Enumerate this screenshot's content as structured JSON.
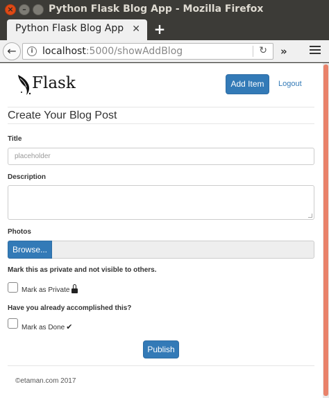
{
  "window": {
    "title": "Python Flask Blog App - Mozilla Firefox"
  },
  "tab": {
    "label": "Python Flask Blog App",
    "close": "✕",
    "new_tab": "+"
  },
  "nav": {
    "url_host": "localhost",
    "url_rest": ":5000/showAddBlog",
    "overflow": "»"
  },
  "header": {
    "logo_text": "Flask",
    "add_item": "Add Item",
    "logout": "Logout"
  },
  "form": {
    "heading": "Create Your Blog Post",
    "title_label": "Title",
    "title_placeholder": "placeholder",
    "description_label": "Description",
    "photos_label": "Photos",
    "browse": "Browse...",
    "private_question": "Mark this as private and not visible to others.",
    "private_label": "Mark as Private",
    "done_question": "Have you already accomplished this?",
    "done_label": "Mark as Done",
    "publish": "Publish"
  },
  "footer": {
    "text": "©etaman.com 2017"
  },
  "colors": {
    "primary": "#337ab7",
    "scroll_thumb": "#e9826a",
    "close_button": "#df4a16"
  }
}
